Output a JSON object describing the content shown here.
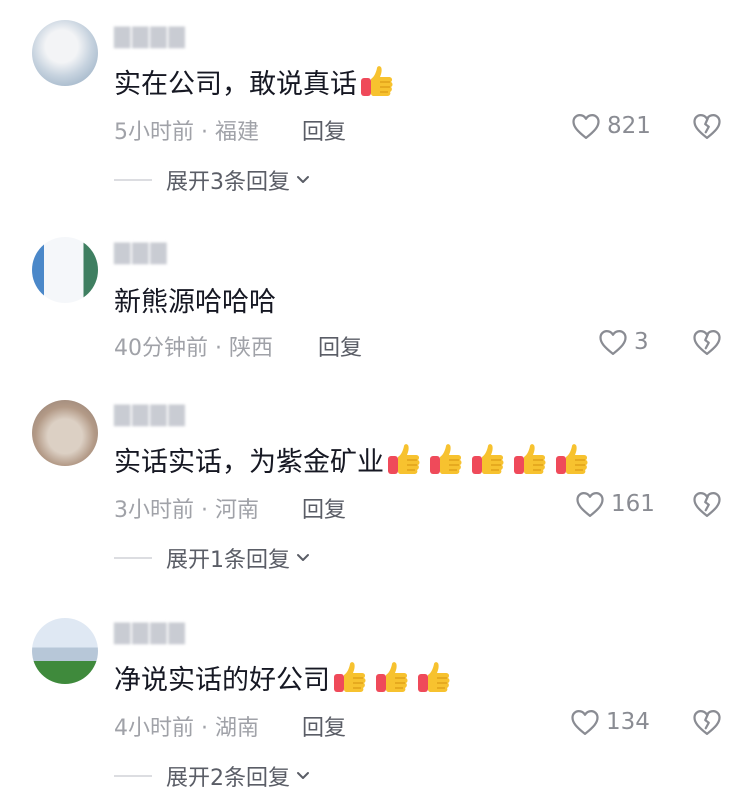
{
  "comments": [
    {
      "username": "▇▇▇▇",
      "text": "实在公司，敢说真话",
      "thumbs": 1,
      "meta": "5小时前 · 福建",
      "reply_label": "回复",
      "likes": "821",
      "expand": "展开3条回复"
    },
    {
      "username": "▇▇▇",
      "text": "新熊源哈哈哈",
      "thumbs": 0,
      "meta": "40分钟前 · 陕西",
      "reply_label": "回复",
      "likes": "3",
      "expand": ""
    },
    {
      "username": "▇▇▇▇",
      "text": "实话实话，为紫金矿业",
      "thumbs": 5,
      "meta": "3小时前 · 河南",
      "reply_label": "回复",
      "likes": "161",
      "expand": "展开1条回复"
    },
    {
      "username": "▇▇▇▇",
      "text": "净说实话的好公司",
      "thumbs": 3,
      "meta": "4小时前 · 湖南",
      "reply_label": "回复",
      "likes": "134",
      "expand": "展开2条回复"
    }
  ],
  "colors": {
    "text": "#161823",
    "meta": "#a0a2a8",
    "reply": "#5a5d66",
    "thumb": "#f7c22f",
    "cuff": "#ef4a5a"
  },
  "icons": {
    "like": "heart-outline-icon",
    "dislike": "broken-heart-icon",
    "emoji": "thumbs-up-emoji",
    "chevron": "chevron-down-icon"
  }
}
